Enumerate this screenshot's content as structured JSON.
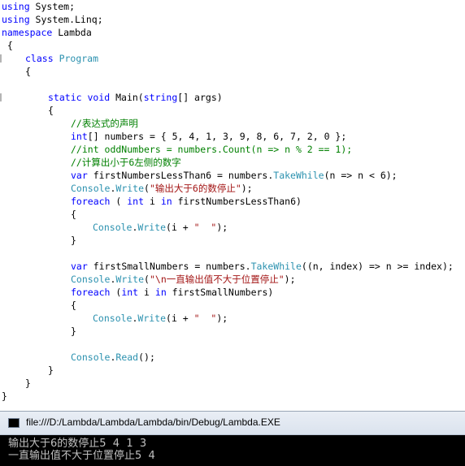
{
  "code": {
    "l1a": "using",
    "l1b": " System;",
    "l2a": "using",
    "l2b": " System.Linq;",
    "l3a": "namespace",
    "l3b": " Lambda",
    "l4": " {",
    "l5a": "class",
    "l5b": "Program",
    "l6": "{",
    "l7a": "static",
    "l7b": "void",
    "l7c": " Main(",
    "l7d": "string",
    "l7e": "[] args)",
    "l8": "{",
    "l9": "//表达式的声明",
    "l10a": "int",
    "l10b": "[] numbers = { 5, 4, 1, 3, 9, 8, 6, 7, 2, 0 };",
    "l11": "//int oddNumbers = numbers.Count(n => n % 2 == 1);",
    "l12": "//计算出小于6左侧的数字",
    "l13a": "var",
    "l13b": " firstNumbersLessThan6 = numbers.",
    "l13c": "TakeWhile",
    "l13d": "(n => n < 6);",
    "l14a": "Console",
    "l14b": ".",
    "l14c": "Write",
    "l14d": "(",
    "l14e": "\"输出大于6的数停止\"",
    "l14f": ");",
    "l15a": "foreach",
    "l15b": " ( ",
    "l15c": "int",
    "l15d": " i ",
    "l15e": "in",
    "l15f": " firstNumbersLessThan6)",
    "l16": "{",
    "l17a": "Console",
    "l17b": ".",
    "l17c": "Write",
    "l17d": "(i + ",
    "l17e": "\"  \"",
    "l17f": ");",
    "l18": "}",
    "l19a": "var",
    "l19b": " firstSmallNumbers = numbers.",
    "l19c": "TakeWhile",
    "l19d": "((n, index) => n >= index);",
    "l20a": "Console",
    "l20b": ".",
    "l20c": "Write",
    "l20d": "(",
    "l20e": "\"\\n一直输出值不大于位置停止\"",
    "l20f": ");",
    "l21a": "foreach",
    "l21b": " (",
    "l21c": "int",
    "l21d": " i ",
    "l21e": "in",
    "l21f": " firstSmallNumbers)",
    "l22": "{",
    "l23a": "Console",
    "l23b": ".",
    "l23c": "Write",
    "l23d": "(i + ",
    "l23e": "\"  \"",
    "l23f": ");",
    "l24": "}",
    "l25a": "Console",
    "l25b": ".",
    "l25c": "Read",
    "l25d": "();",
    "l26": "}",
    "l27": "}",
    "l28": "}"
  },
  "console": {
    "title": "file:///D:/Lambda/Lambda/Lambda/bin/Debug/Lambda.EXE",
    "output1": "输出大于6的数停止5  4  1  3",
    "output2": "一直输出值不大于位置停止5  4"
  },
  "colors": {
    "keyword": "#0000ff",
    "type": "#2b91af",
    "comment": "#008000",
    "string": "#a31515",
    "console_bg": "#000000",
    "console_text": "#c0c0c0"
  }
}
